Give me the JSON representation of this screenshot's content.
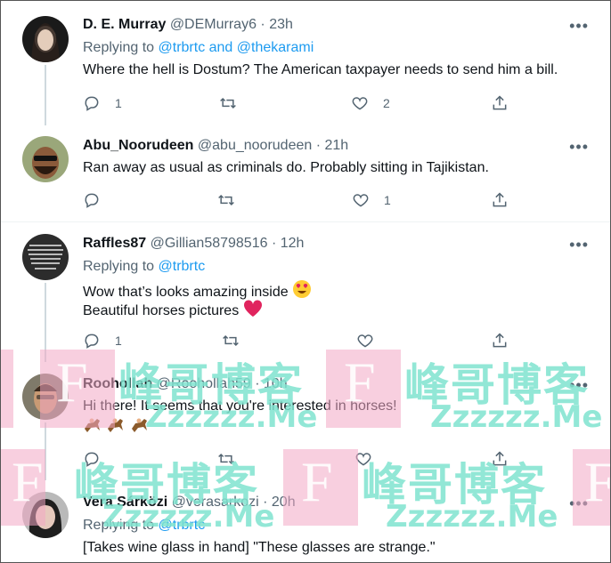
{
  "tweets": [
    {
      "name": "D. E. Murray",
      "handle": "@DEMurray6",
      "sep": "·",
      "time": "23h",
      "more": "•••",
      "replying_prefix": "Replying to ",
      "replying_links": "@trbrtc and @thekarami",
      "lines": [
        "Where the hell is Dostum? The American taxpayer needs to send him a bill."
      ],
      "reply_count": "1",
      "retweet_count": "",
      "like_count": "2"
    },
    {
      "name": "Abu_Noorudeen",
      "handle": "@abu_noorudeen",
      "sep": "·",
      "time": "21h",
      "more": "•••",
      "lines": [
        "Ran away as usual as criminals do. Probably sitting in Tajikistan."
      ],
      "reply_count": "",
      "retweet_count": "",
      "like_count": "1"
    },
    {
      "name": "Raffles87",
      "handle": "@Gillian58798516",
      "sep": "·",
      "time": "12h",
      "more": "•••",
      "replying_prefix": "Replying to ",
      "replying_links": "@trbrtc",
      "lines": [
        "Wow that’s looks amazing inside",
        "Beautiful horses pictures"
      ],
      "reply_count": "1",
      "retweet_count": "",
      "like_count": ""
    },
    {
      "name": "Roohollah",
      "handle": "@Roohollah59",
      "sep": "·",
      "time": "10h",
      "more": "•••",
      "lines": [
        "Hi there! It seems that you're interested in horses!"
      ],
      "reply_count": "",
      "retweet_count": "",
      "like_count": ""
    },
    {
      "name": "Vera Sárközi",
      "handle": "@verasarkozi",
      "sep": "·",
      "time": "20h",
      "more": "•••",
      "replying_prefix": "Replying to ",
      "replying_links": "@trbrtc",
      "lines": [
        "[Takes wine glass in hand] \"These glasses are strange.\""
      ]
    }
  ],
  "watermark": {
    "letter": "F",
    "brand": "峰哥博客",
    "domain": "Zzzzzz.Me"
  },
  "icons": {
    "reply": "reply-icon",
    "retweet": "retweet-icon",
    "like": "heart-icon",
    "share": "share-icon",
    "more": "more-icon"
  },
  "colors": {
    "link": "#1d9bf0",
    "muted": "#536471",
    "heart_emoji": "#e0245e",
    "watermark_pink": "#f2a7c5",
    "watermark_teal": "#7fe3cf"
  }
}
